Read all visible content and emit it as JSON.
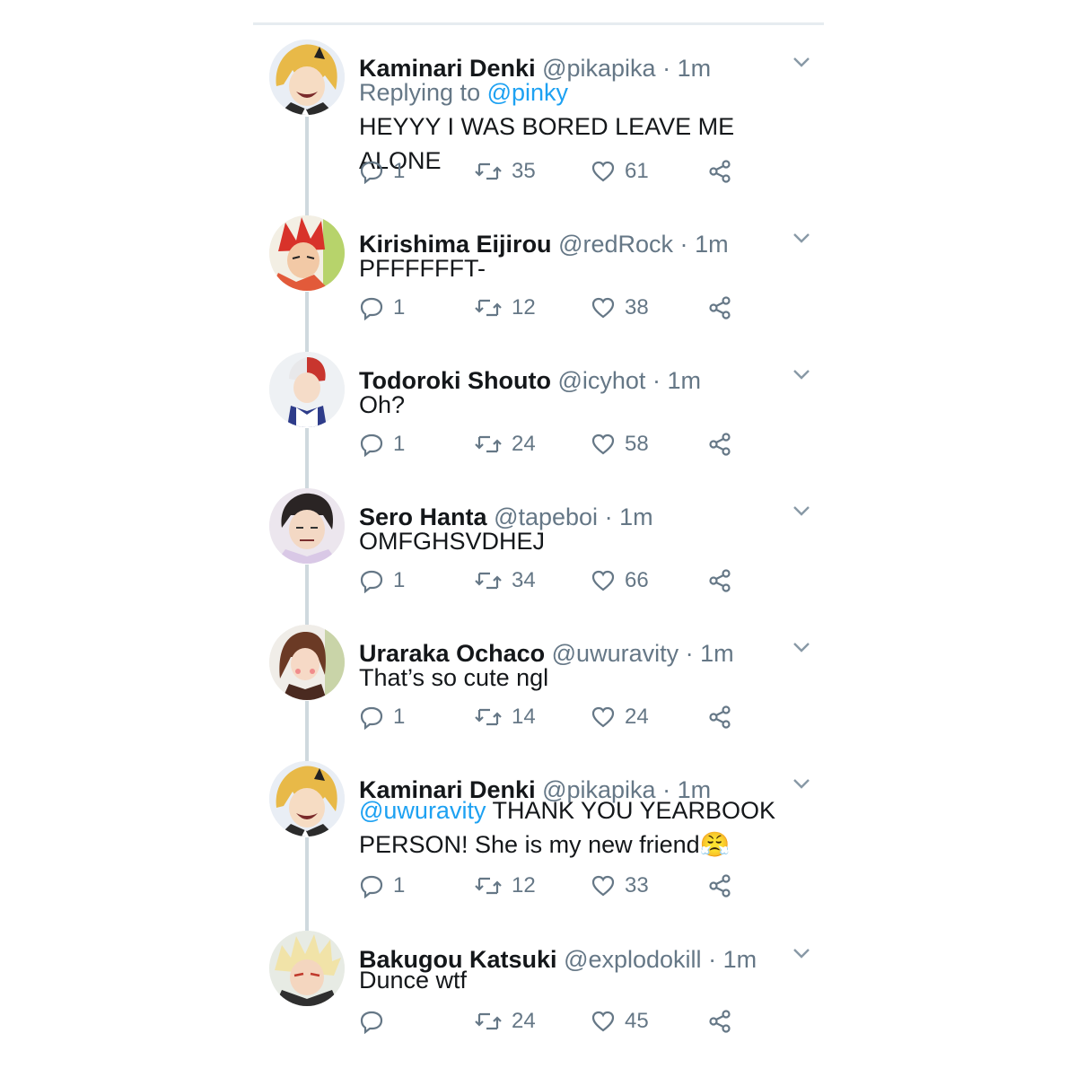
{
  "thread": {
    "reply_context_prefix": "Replying to",
    "tweets": [
      {
        "name": "Kaminari Denki",
        "handle": "@pikapika",
        "time": "1m",
        "reply_to": "@pinky",
        "mention": "",
        "text": "HEYYY I WAS BORED LEAVE ME ALONE",
        "replies": "1",
        "retweets": "35",
        "likes": "61",
        "avatar": "kaminari-avatar"
      },
      {
        "name": "Kirishima Eijirou",
        "handle": "@redRock",
        "time": "1m",
        "reply_to": "",
        "mention": "",
        "text": "PFFFFFFT-",
        "replies": "1",
        "retweets": "12",
        "likes": "38",
        "avatar": "kirishima-avatar"
      },
      {
        "name": "Todoroki Shouto",
        "handle": "@icyhot",
        "time": "1m",
        "reply_to": "",
        "mention": "",
        "text": "Oh?",
        "replies": "1",
        "retweets": "24",
        "likes": "58",
        "avatar": "todoroki-avatar"
      },
      {
        "name": "Sero Hanta",
        "handle": "@tapeboi",
        "time": "1m",
        "reply_to": "",
        "mention": "",
        "text": "OMFGHSVDHEJ",
        "replies": "1",
        "retweets": "34",
        "likes": "66",
        "avatar": "sero-avatar"
      },
      {
        "name": "Uraraka Ochaco",
        "handle": "@uwuravity",
        "time": "1m",
        "reply_to": "",
        "mention": "",
        "text": "That’s so cute ngl",
        "replies": "1",
        "retweets": "14",
        "likes": "24",
        "avatar": "uraraka-avatar"
      },
      {
        "name": "Kaminari Denki",
        "handle": "@pikapika",
        "time": "1m",
        "reply_to": "",
        "mention": "@uwuravity",
        "text": " THANK YOU YEARBOOK PERSON! She is my new friend😤",
        "replies": "1",
        "retweets": "12",
        "likes": "33",
        "avatar": "kaminari-avatar"
      },
      {
        "name": "Bakugou Katsuki",
        "handle": "@explodokill",
        "time": "1m",
        "reply_to": "",
        "mention": "",
        "text": "Dunce wtf",
        "replies": "",
        "retweets": "24",
        "likes": "45",
        "avatar": "bakugou-avatar"
      }
    ]
  },
  "colors": {
    "name": "#14171a",
    "secondary": "#657786",
    "link": "#1da1f2",
    "thread_line": "#cfd9de"
  },
  "icons": [
    "reply-icon",
    "retweet-icon",
    "like-icon",
    "share-icon",
    "chevron-down-icon"
  ]
}
